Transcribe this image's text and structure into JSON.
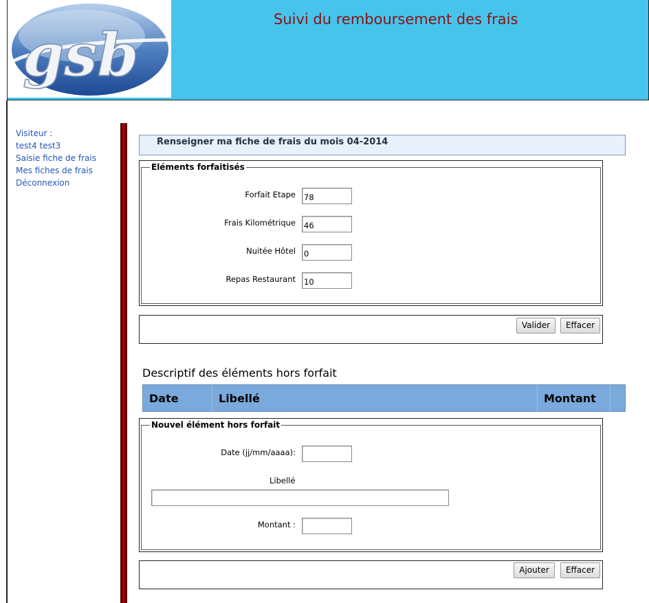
{
  "header": {
    "logo_text": "gsb",
    "title": "Suivi du remboursement des frais"
  },
  "menu": {
    "visitor_label": "Visiteur :",
    "user_name": "test4 test3",
    "items": [
      {
        "label": "Saisie fiche de frais"
      },
      {
        "label": "Mes fiches de frais"
      },
      {
        "label": "Déconnexion"
      }
    ]
  },
  "main": {
    "title": "Renseigner ma fiche de frais du mois 04-2014",
    "forfait": {
      "legend": "Eléments forfaitisés",
      "fields": [
        {
          "label": "Forfait Etape",
          "value": "78"
        },
        {
          "label": "Frais Kilométrique",
          "value": "46"
        },
        {
          "label": "Nuitée Hôtel",
          "value": "0"
        },
        {
          "label": "Repas Restaurant",
          "value": "10"
        }
      ],
      "validate_label": "Valider",
      "clear_label": "Effacer"
    },
    "hors_forfait": {
      "title": "Descriptif des éléments hors forfait",
      "columns": [
        "Date",
        "Libellé",
        "Montant"
      ]
    },
    "new_item": {
      "legend": "Nouvel élément hors forfait",
      "date_label": "Date (jj/mm/aaaa):",
      "date_value": "",
      "libelle_label": "Libellé",
      "libelle_value": "",
      "montant_label": "Montant :",
      "montant_value": "",
      "add_label": "Ajouter",
      "clear_label": "Effacer"
    }
  }
}
